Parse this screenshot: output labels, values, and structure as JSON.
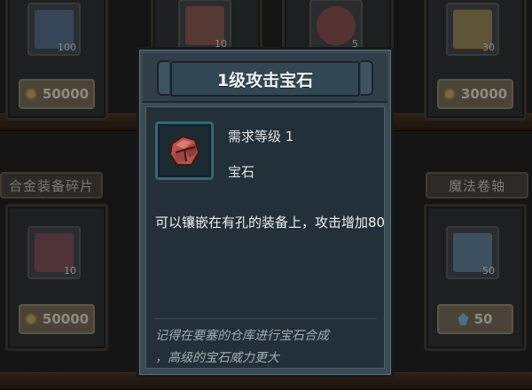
{
  "shop": {
    "top_row": [
      {
        "icon": "map-scroll-icon",
        "quantity": "100",
        "price": "50000",
        "currency": "gold-coin-icon"
      },
      {
        "icon": "meat-icon",
        "quantity": "10",
        "price": "",
        "currency": ""
      },
      {
        "icon": "steak-icon",
        "quantity": "5",
        "price": "",
        "currency": ""
      },
      {
        "icon": "golden-crystal-icon",
        "quantity": "30",
        "price": "30000",
        "currency": "gold-coin-icon"
      }
    ],
    "categories": {
      "left": "合金装备碎片",
      "right": "魔法卷轴"
    },
    "bottom_row": [
      {
        "icon": "red-crystal-shard-icon",
        "quantity": "10",
        "price": "50000",
        "currency": "gold-coin-icon"
      },
      {
        "icon": "magic-scroll-icon",
        "quantity": "50",
        "price": "50",
        "currency": "gem-icon"
      }
    ]
  },
  "tooltip": {
    "title": "1级攻击宝石",
    "required_level": "需求等级 1",
    "item_type": "宝石",
    "item_icon": "red-attack-gem-icon",
    "description": "可以镶嵌在有孔的装备上，攻击增加80",
    "flavor_line1": "记得在要塞的仓库进行宝石合成",
    "flavor_line2": "，高级的宝石威力更大"
  },
  "colors": {
    "panel": "#3a4b55",
    "panel_body": "#233039",
    "icon_frame": "#2e6a77",
    "gem": "#c4584f"
  }
}
